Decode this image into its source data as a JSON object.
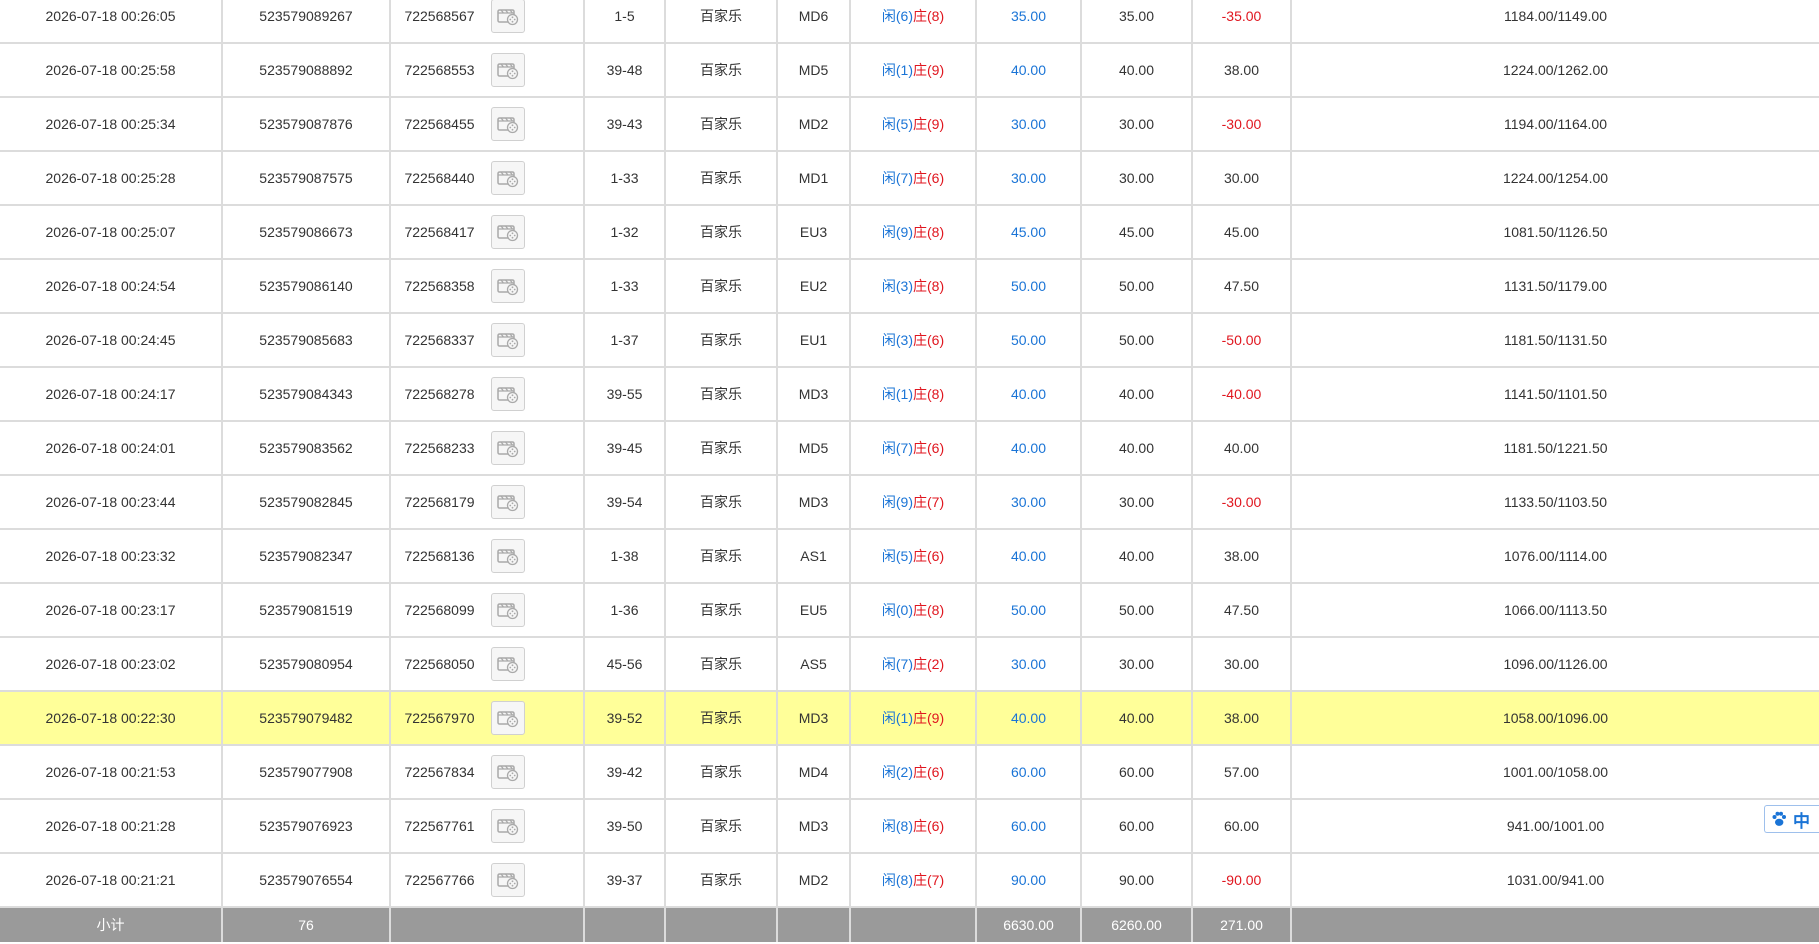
{
  "rows": [
    {
      "time": "2026-07-18 00:26:05",
      "bet_id": "523579089267",
      "round": "722568567",
      "shoe": "1-5",
      "game": "百家乐",
      "table": "MD6",
      "player": "闲(6)",
      "banker": "庄(8)",
      "bet": "35.00",
      "valid": "35.00",
      "win": "-35.00",
      "win_neg": true,
      "balance": "1184.00/1149.00"
    },
    {
      "time": "2026-07-18 00:25:58",
      "bet_id": "523579088892",
      "round": "722568553",
      "shoe": "39-48",
      "game": "百家乐",
      "table": "MD5",
      "player": "闲(1)",
      "banker": "庄(9)",
      "bet": "40.00",
      "valid": "40.00",
      "win": "38.00",
      "win_neg": false,
      "balance": "1224.00/1262.00"
    },
    {
      "time": "2026-07-18 00:25:34",
      "bet_id": "523579087876",
      "round": "722568455",
      "shoe": "39-43",
      "game": "百家乐",
      "table": "MD2",
      "player": "闲(5)",
      "banker": "庄(9)",
      "bet": "30.00",
      "valid": "30.00",
      "win": "-30.00",
      "win_neg": true,
      "balance": "1194.00/1164.00"
    },
    {
      "time": "2026-07-18 00:25:28",
      "bet_id": "523579087575",
      "round": "722568440",
      "shoe": "1-33",
      "game": "百家乐",
      "table": "MD1",
      "player": "闲(7)",
      "banker": "庄(6)",
      "bet": "30.00",
      "valid": "30.00",
      "win": "30.00",
      "win_neg": false,
      "balance": "1224.00/1254.00"
    },
    {
      "time": "2026-07-18 00:25:07",
      "bet_id": "523579086673",
      "round": "722568417",
      "shoe": "1-32",
      "game": "百家乐",
      "table": "EU3",
      "player": "闲(9)",
      "banker": "庄(8)",
      "bet": "45.00",
      "valid": "45.00",
      "win": "45.00",
      "win_neg": false,
      "balance": "1081.50/1126.50"
    },
    {
      "time": "2026-07-18 00:24:54",
      "bet_id": "523579086140",
      "round": "722568358",
      "shoe": "1-33",
      "game": "百家乐",
      "table": "EU2",
      "player": "闲(3)",
      "banker": "庄(8)",
      "bet": "50.00",
      "valid": "50.00",
      "win": "47.50",
      "win_neg": false,
      "balance": "1131.50/1179.00"
    },
    {
      "time": "2026-07-18 00:24:45",
      "bet_id": "523579085683",
      "round": "722568337",
      "shoe": "1-37",
      "game": "百家乐",
      "table": "EU1",
      "player": "闲(3)",
      "banker": "庄(6)",
      "bet": "50.00",
      "valid": "50.00",
      "win": "-50.00",
      "win_neg": true,
      "balance": "1181.50/1131.50"
    },
    {
      "time": "2026-07-18 00:24:17",
      "bet_id": "523579084343",
      "round": "722568278",
      "shoe": "39-55",
      "game": "百家乐",
      "table": "MD3",
      "player": "闲(1)",
      "banker": "庄(8)",
      "bet": "40.00",
      "valid": "40.00",
      "win": "-40.00",
      "win_neg": true,
      "balance": "1141.50/1101.50"
    },
    {
      "time": "2026-07-18 00:24:01",
      "bet_id": "523579083562",
      "round": "722568233",
      "shoe": "39-45",
      "game": "百家乐",
      "table": "MD5",
      "player": "闲(7)",
      "banker": "庄(6)",
      "bet": "40.00",
      "valid": "40.00",
      "win": "40.00",
      "win_neg": false,
      "balance": "1181.50/1221.50"
    },
    {
      "time": "2026-07-18 00:23:44",
      "bet_id": "523579082845",
      "round": "722568179",
      "shoe": "39-54",
      "game": "百家乐",
      "table": "MD3",
      "player": "闲(9)",
      "banker": "庄(7)",
      "bet": "30.00",
      "valid": "30.00",
      "win": "-30.00",
      "win_neg": true,
      "balance": "1133.50/1103.50"
    },
    {
      "time": "2026-07-18 00:23:32",
      "bet_id": "523579082347",
      "round": "722568136",
      "shoe": "1-38",
      "game": "百家乐",
      "table": "AS1",
      "player": "闲(5)",
      "banker": "庄(6)",
      "bet": "40.00",
      "valid": "40.00",
      "win": "38.00",
      "win_neg": false,
      "balance": "1076.00/1114.00"
    },
    {
      "time": "2026-07-18 00:23:17",
      "bet_id": "523579081519",
      "round": "722568099",
      "shoe": "1-36",
      "game": "百家乐",
      "table": "EU5",
      "player": "闲(0)",
      "banker": "庄(8)",
      "bet": "50.00",
      "valid": "50.00",
      "win": "47.50",
      "win_neg": false,
      "balance": "1066.00/1113.50"
    },
    {
      "time": "2026-07-18 00:23:02",
      "bet_id": "523579080954",
      "round": "722568050",
      "shoe": "45-56",
      "game": "百家乐",
      "table": "AS5",
      "player": "闲(7)",
      "banker": "庄(2)",
      "bet": "30.00",
      "valid": "30.00",
      "win": "30.00",
      "win_neg": false,
      "balance": "1096.00/1126.00"
    },
    {
      "time": "2026-07-18 00:22:30",
      "bet_id": "523579079482",
      "round": "722567970",
      "shoe": "39-52",
      "game": "百家乐",
      "table": "MD3",
      "player": "闲(1)",
      "banker": "庄(9)",
      "bet": "40.00",
      "valid": "40.00",
      "win": "38.00",
      "win_neg": false,
      "balance": "1058.00/1096.00",
      "highlighted": true
    },
    {
      "time": "2026-07-18 00:21:53",
      "bet_id": "523579077908",
      "round": "722567834",
      "shoe": "39-42",
      "game": "百家乐",
      "table": "MD4",
      "player": "闲(2)",
      "banker": "庄(6)",
      "bet": "60.00",
      "valid": "60.00",
      "win": "57.00",
      "win_neg": false,
      "balance": "1001.00/1058.00"
    },
    {
      "time": "2026-07-18 00:21:28",
      "bet_id": "523579076923",
      "round": "722567761",
      "shoe": "39-50",
      "game": "百家乐",
      "table": "MD3",
      "player": "闲(8)",
      "banker": "庄(6)",
      "bet": "60.00",
      "valid": "60.00",
      "win": "60.00",
      "win_neg": false,
      "balance": "941.00/1001.00"
    },
    {
      "time": "2026-07-18 00:21:21",
      "bet_id": "523579076554",
      "round": "722567766",
      "shoe": "39-37",
      "game": "百家乐",
      "table": "MD2",
      "player": "闲(8)",
      "banker": "庄(7)",
      "bet": "90.00",
      "valid": "90.00",
      "win": "-90.00",
      "win_neg": true,
      "balance": "1031.00/941.00"
    }
  ],
  "subtotal": {
    "label": "小计",
    "count": "76",
    "bet": "6630.00",
    "valid": "6260.00",
    "win": "271.00"
  },
  "ime": {
    "icon": "paw-icon",
    "lang": "中"
  },
  "colors": {
    "blue": "#1a74d6",
    "red": "#e0161f",
    "highlight": "#ffff99",
    "subtotal_bg": "#9a9a9a"
  }
}
